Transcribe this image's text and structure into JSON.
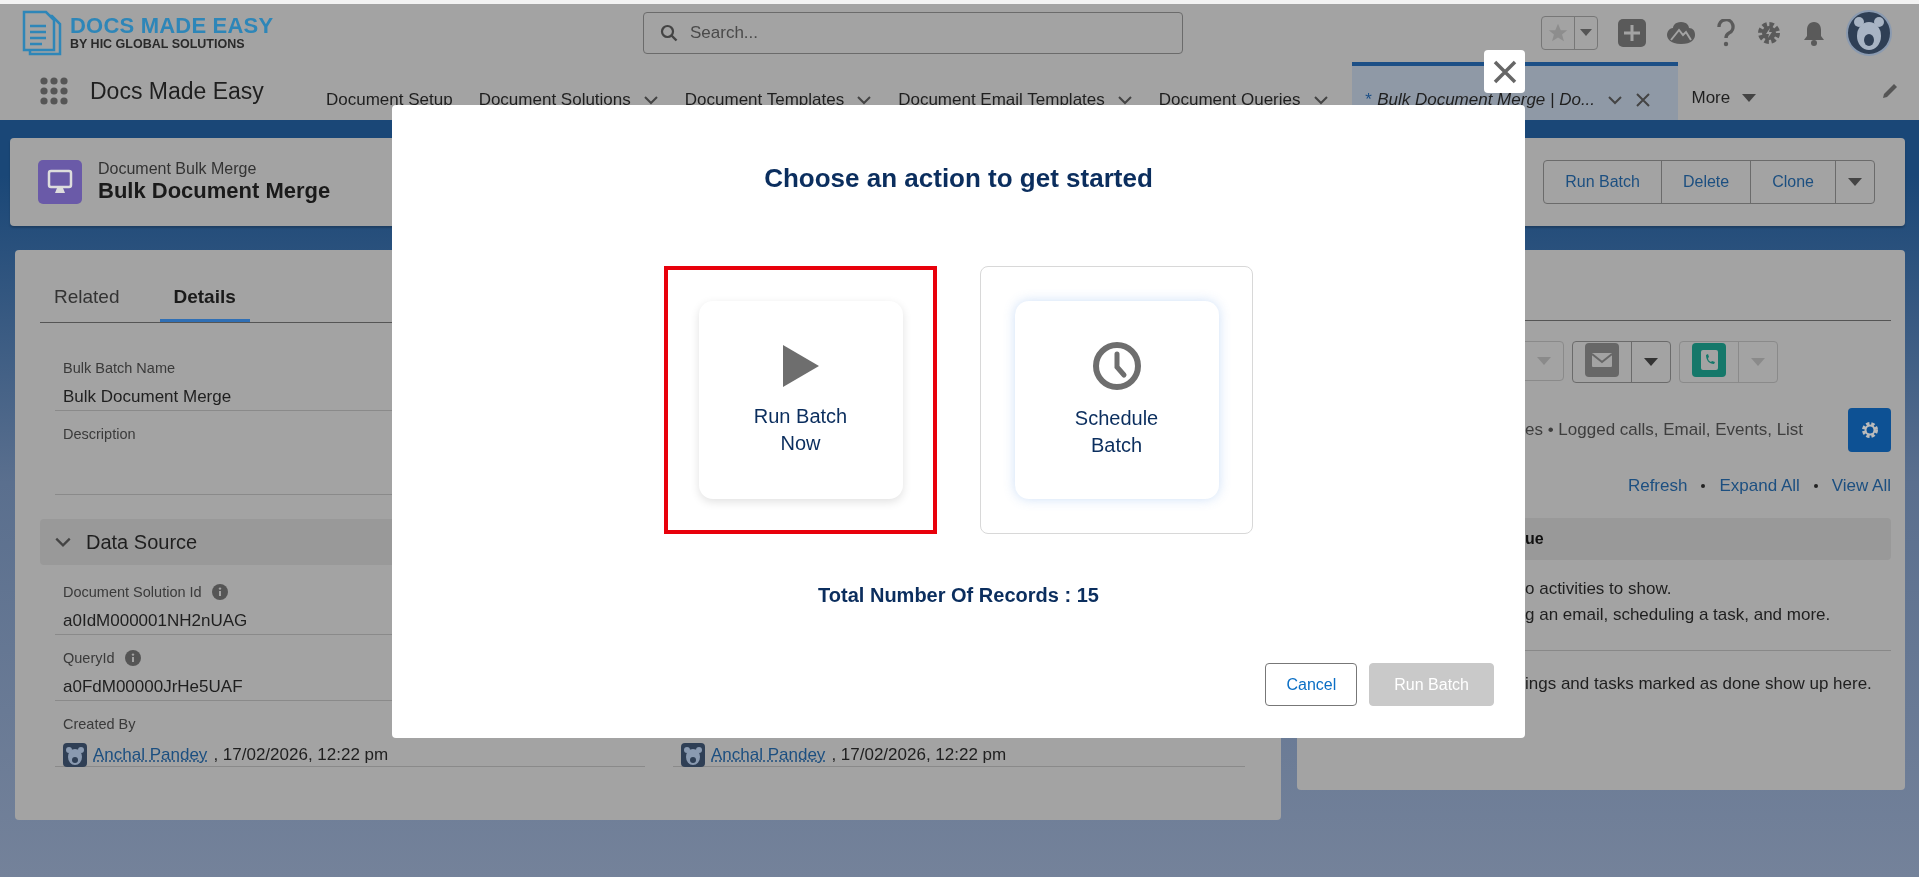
{
  "app": {
    "logo_title": "DOCS MADE EASY",
    "logo_subtitle": "BY HIC GLOBAL SOLUTIONS",
    "name": "Docs Made Easy"
  },
  "search": {
    "placeholder": "Search..."
  },
  "nav_tabs": [
    {
      "label": "Document Setup",
      "has_menu": false,
      "selected": false
    },
    {
      "label": "Document Solutions",
      "has_menu": true,
      "selected": false
    },
    {
      "label": "Document Templates",
      "has_menu": true,
      "selected": false
    },
    {
      "label": "Document Email Templates",
      "has_menu": true,
      "selected": false
    },
    {
      "label": "Document Queries",
      "has_menu": true,
      "selected": false
    },
    {
      "label": "Bulk Document Merge | Do...",
      "marker": "*",
      "has_menu": true,
      "selected": true
    }
  ],
  "more": "More",
  "record": {
    "object": "Document Bulk Merge",
    "title": "Bulk Document Merge",
    "actions": [
      "Run Batch",
      "Delete",
      "Clone"
    ]
  },
  "detail_tabs": [
    {
      "label": "Related",
      "selected": false
    },
    {
      "label": "Details",
      "selected": true
    }
  ],
  "fields": [
    {
      "label": "Bulk Batch Name",
      "value": "Bulk Document Merge"
    },
    {
      "label": "Description"
    }
  ],
  "section": {
    "title": "Data Source",
    "expanded": true
  },
  "section_fields": [
    {
      "label": "Document Solution Id",
      "info": true,
      "value": "a0IdM000001NH2nUAG"
    },
    {
      "label": "QueryId",
      "info": true,
      "value": "a0FdM00000JrHe5UAF"
    },
    {
      "label": "Created By",
      "user": "Anchal Pandey",
      "value": ", 17/02/2026, 12:22 pm"
    }
  ],
  "modified_by": {
    "user": "Anchal Pandey",
    "value": ", 17/02/2026, 12:22 pm"
  },
  "activity": {
    "filter_text": "es • Logged calls, Email, Events, List",
    "links": [
      "Refresh",
      "Expand All",
      "View All"
    ],
    "group_label": "ue",
    "empty_lines": [
      "o activities to show.",
      "g an email, scheduling a task, and more."
    ],
    "past_text": "ings and tasks marked as done show up here."
  },
  "modal": {
    "title": "Choose an action to get started",
    "options": [
      {
        "label": "Run Batch Now",
        "kind": "run",
        "selected": true
      },
      {
        "label": "Schedule Batch",
        "kind": "schedule",
        "selected": false
      }
    ],
    "total_label": "Total Number Of Records : 15",
    "buttons": [
      {
        "label": "Cancel",
        "disabled": false
      },
      {
        "label": "Run Batch",
        "disabled": true
      }
    ]
  }
}
